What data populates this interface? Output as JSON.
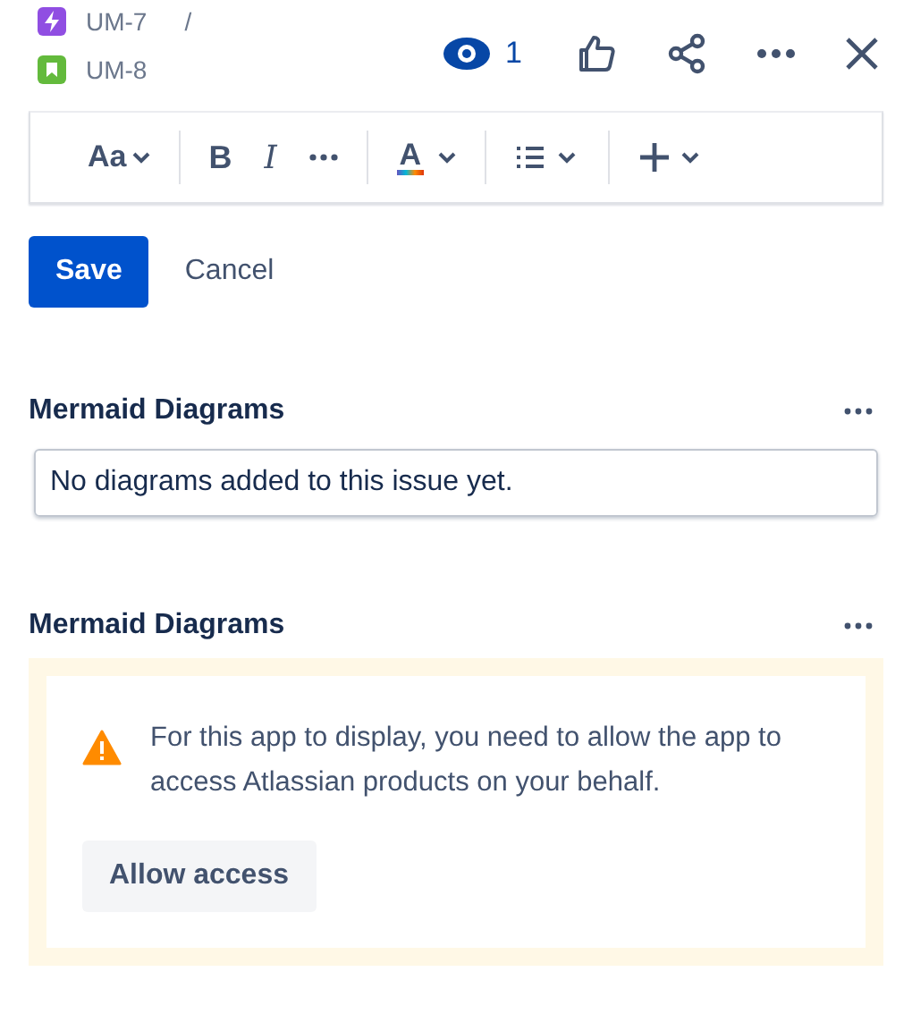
{
  "breadcrumbs": [
    {
      "kind": "epic",
      "key": "UM-7",
      "separator": "/"
    },
    {
      "kind": "story",
      "key": "UM-8"
    }
  ],
  "header": {
    "watchers": "1"
  },
  "toolbar": {
    "groups": [
      [
        {
          "kind": "text-style",
          "label": "Aa"
        }
      ],
      [
        {
          "kind": "bold",
          "label": "B"
        },
        {
          "kind": "italic",
          "label": "I"
        },
        {
          "kind": "more"
        }
      ],
      [
        {
          "kind": "color",
          "label": "A"
        }
      ],
      [
        {
          "kind": "list"
        }
      ],
      [
        {
          "kind": "insert"
        }
      ]
    ]
  },
  "actions": {
    "save": "Save",
    "cancel": "Cancel"
  },
  "panels": [
    {
      "kind": "empty",
      "title": "Mermaid Diagrams",
      "message": "No diagrams added to this issue yet."
    },
    {
      "kind": "consent",
      "title": "Mermaid Diagrams",
      "message": "For this app to display, you need to allow the app to access Atlassian products on your behalf.",
      "button": "Allow access"
    }
  ]
}
